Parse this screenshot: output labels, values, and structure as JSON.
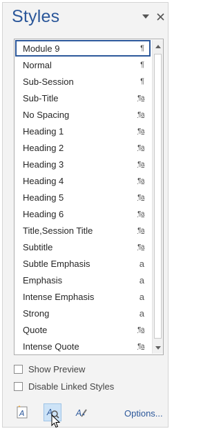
{
  "pane": {
    "title": "Styles",
    "dropdown_icon": "triangle-down-icon",
    "close_icon": "close-icon"
  },
  "styles": [
    {
      "name": "Module 9",
      "mark": "¶",
      "kind": "paragraph",
      "selected": true
    },
    {
      "name": "Normal",
      "mark": "¶",
      "kind": "paragraph"
    },
    {
      "name": "Sub-Session",
      "mark": "¶",
      "kind": "paragraph"
    },
    {
      "name": "Sub-Title",
      "mark": "¶a",
      "kind": "linked"
    },
    {
      "name": "No Spacing",
      "mark": "¶a",
      "kind": "linked"
    },
    {
      "name": "Heading 1",
      "mark": "¶a",
      "kind": "linked"
    },
    {
      "name": "Heading 2",
      "mark": "¶a",
      "kind": "linked"
    },
    {
      "name": "Heading 3",
      "mark": "¶a",
      "kind": "linked"
    },
    {
      "name": "Heading 4",
      "mark": "¶a",
      "kind": "linked"
    },
    {
      "name": "Heading 5",
      "mark": "¶a",
      "kind": "linked"
    },
    {
      "name": "Heading 6",
      "mark": "¶a",
      "kind": "linked"
    },
    {
      "name": "Title,Session Title",
      "mark": "¶a",
      "kind": "linked"
    },
    {
      "name": "Subtitle",
      "mark": "¶a",
      "kind": "linked"
    },
    {
      "name": "Subtle Emphasis",
      "mark": "a",
      "kind": "character"
    },
    {
      "name": "Emphasis",
      "mark": "a",
      "kind": "character"
    },
    {
      "name": "Intense Emphasis",
      "mark": "a",
      "kind": "character"
    },
    {
      "name": "Strong",
      "mark": "a",
      "kind": "character"
    },
    {
      "name": "Quote",
      "mark": "¶a",
      "kind": "linked"
    },
    {
      "name": "Intense Quote",
      "mark": "¶a",
      "kind": "linked"
    }
  ],
  "options": {
    "show_preview": {
      "label": "Show Preview",
      "checked": false
    },
    "disable_linked": {
      "label": "Disable Linked Styles",
      "checked": false
    }
  },
  "buttons": {
    "new_style_icon": "new-style-icon",
    "inspector_icon": "style-inspector-icon",
    "manage_icon": "manage-styles-icon",
    "options_label": "Options..."
  },
  "colors": {
    "accent": "#2b579a",
    "pane_bg": "#f3f3f3",
    "hover_bg": "#cde3f7"
  }
}
